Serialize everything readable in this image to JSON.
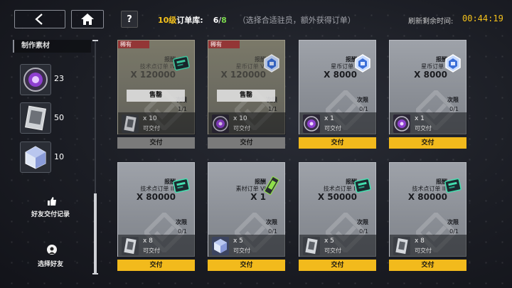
{
  "header": {
    "back_icon": "chevron-left-icon",
    "home_icon": "home-icon",
    "help_label": "?",
    "order_level": "10级",
    "order_level_suffix": "订单库:",
    "order_count_current": "6",
    "order_count_sep": "/",
    "order_count_max": "8",
    "hint": "（选择合适驻员，额外获得订单）",
    "refresh_label": "刷新剩余时间:",
    "refresh_time": "00:44:19"
  },
  "sidebar": {
    "title": "制作素材",
    "materials": [
      {
        "icon": "purple-orb-icon",
        "count": "23"
      },
      {
        "icon": "data-card-icon",
        "count": "50"
      },
      {
        "icon": "crystal-cube-icon",
        "count": "10"
      }
    ],
    "friend_records_label": "好友交付记录",
    "choose_friend_label": "选择好友"
  },
  "orders": [
    {
      "rare": "稀有",
      "reward_label": "报酬",
      "name": "技术点订单 IV",
      "amount": "X 120000",
      "reward_icon": "exp-chip-icon",
      "sold_out": "售罄",
      "limit_label": "次限",
      "limit": "1/1",
      "req_icon": "data-card-icon",
      "req_qty": "x 10",
      "req_status": "可交付",
      "submit": "交付",
      "sold": true
    },
    {
      "rare": "稀有",
      "reward_label": "报酬",
      "name": "星币订单 VI",
      "amount": "X 120000",
      "reward_icon": "star-coin-icon",
      "sold_out": "售罄",
      "limit_label": "次限",
      "limit": "1/1",
      "req_icon": "purple-orb-icon",
      "req_qty": "x 10",
      "req_status": "可交付",
      "submit": "交付",
      "sold": true
    },
    {
      "rare": "",
      "reward_label": "报酬",
      "name": "星币订单 I",
      "amount": "X 8000",
      "reward_icon": "star-coin-icon",
      "sold_out": "",
      "limit_label": "次限",
      "limit": "0/1",
      "req_icon": "purple-orb-icon",
      "req_qty": "x 1",
      "req_status": "可交付",
      "submit": "交付",
      "sold": false
    },
    {
      "rare": "",
      "reward_label": "报酬",
      "name": "星币订单 I",
      "amount": "X 8000",
      "reward_icon": "star-coin-icon",
      "sold_out": "",
      "limit_label": "次限",
      "limit": "0/1",
      "req_icon": "purple-orb-icon",
      "req_qty": "x 1",
      "req_status": "可交付",
      "submit": "交付",
      "sold": false
    },
    {
      "rare": "",
      "reward_label": "报酬",
      "name": "技术点订单 III",
      "amount": "X 80000",
      "reward_icon": "exp-chip-icon",
      "sold_out": "",
      "limit_label": "次限",
      "limit": "0/1",
      "req_icon": "data-card-icon",
      "req_qty": "x 8",
      "req_status": "可交付",
      "submit": "交付",
      "sold": false
    },
    {
      "rare": "",
      "reward_label": "报酬",
      "name": "素材订单 VI",
      "amount": "X 1",
      "reward_icon": "green-chip-icon",
      "sold_out": "",
      "limit_label": "次限",
      "limit": "0/1",
      "req_icon": "crystal-cube-icon",
      "req_qty": "x 5",
      "req_status": "可交付",
      "submit": "交付",
      "sold": false
    },
    {
      "rare": "",
      "reward_label": "报酬",
      "name": "技术点订单 II",
      "amount": "X 50000",
      "reward_icon": "exp-chip-icon",
      "sold_out": "",
      "limit_label": "次限",
      "limit": "0/1",
      "req_icon": "data-card-icon",
      "req_qty": "x 5",
      "req_status": "可交付",
      "submit": "交付",
      "sold": false
    },
    {
      "rare": "",
      "reward_label": "报酬",
      "name": "技术点订单 III",
      "amount": "X 80000",
      "reward_icon": "exp-chip-icon",
      "sold_out": "",
      "limit_label": "次限",
      "limit": "0/1",
      "req_icon": "data-card-icon",
      "req_qty": "x 8",
      "req_status": "可交付",
      "submit": "交付",
      "sold": false
    }
  ],
  "colors": {
    "accent": "#f2ba1c",
    "rare": "#a83e3e",
    "count_max": "#7bd84d",
    "level": "#f5c21b"
  }
}
